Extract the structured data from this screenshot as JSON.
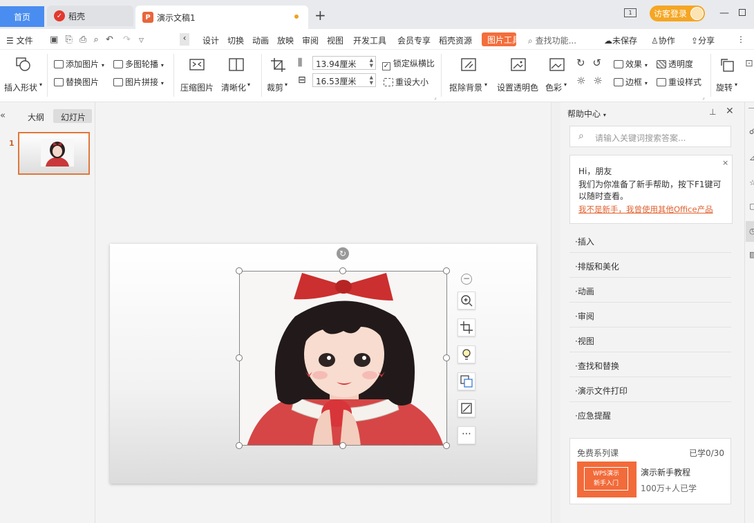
{
  "tabs": {
    "home": "首页",
    "daoke": "稻壳",
    "doc": "演示文稿1"
  },
  "titlebar": {
    "login": "访客登录",
    "layout_badge": "1"
  },
  "menu": {
    "file": "文件",
    "items": [
      "设计",
      "切换",
      "动画",
      "放映",
      "审阅",
      "视图",
      "开发工具",
      "会员专享",
      "稻壳资源"
    ],
    "picture_tools": "图片工具",
    "search": "查找功能...",
    "unsaved": "未保存",
    "collab": "协作",
    "share": "分享"
  },
  "ribbon": {
    "insert_shape": "插入形状",
    "add_picture": "添加图片",
    "multi_carousel": "多图轮播",
    "replace_picture": "替换图片",
    "picture_stitch": "图片拼接",
    "compress_picture": "压缩图片",
    "sharpen": "清晰化",
    "crop": "裁剪",
    "height_value": "13.94厘米",
    "width_value": "16.53厘米",
    "lock_aspect": "锁定纵横比",
    "reset_size": "重设大小",
    "remove_bg": "抠除背景",
    "set_transparent": "设置透明色",
    "color": "色彩",
    "effects": "效果",
    "transparency": "透明度",
    "border": "边框",
    "reset_style": "重设样式",
    "rotate": "旋转"
  },
  "left_panel": {
    "outline_tab": "大纲",
    "slides_tab": "幻灯片",
    "slide_number": "1"
  },
  "help": {
    "title": "帮助中心",
    "search_placeholder": "请输入关键词搜索答案...",
    "greeting": "Hi，朋友",
    "intro": "我们为你准备了新手帮助，按下F1键可以随时查看。",
    "link": "我不是新手，我曾使用其他Office产品",
    "items": [
      "插入",
      "排版和美化",
      "动画",
      "审阅",
      "视图",
      "查找和替换",
      "演示文件打印",
      "应急提醒"
    ],
    "course_title": "免费系列课",
    "course_progress": "已学0/30",
    "course_badge_line1": "WPS演示",
    "course_badge_line2": "新手入门",
    "course_name": "演示新手教程",
    "course_learners": "100万+人已学"
  }
}
